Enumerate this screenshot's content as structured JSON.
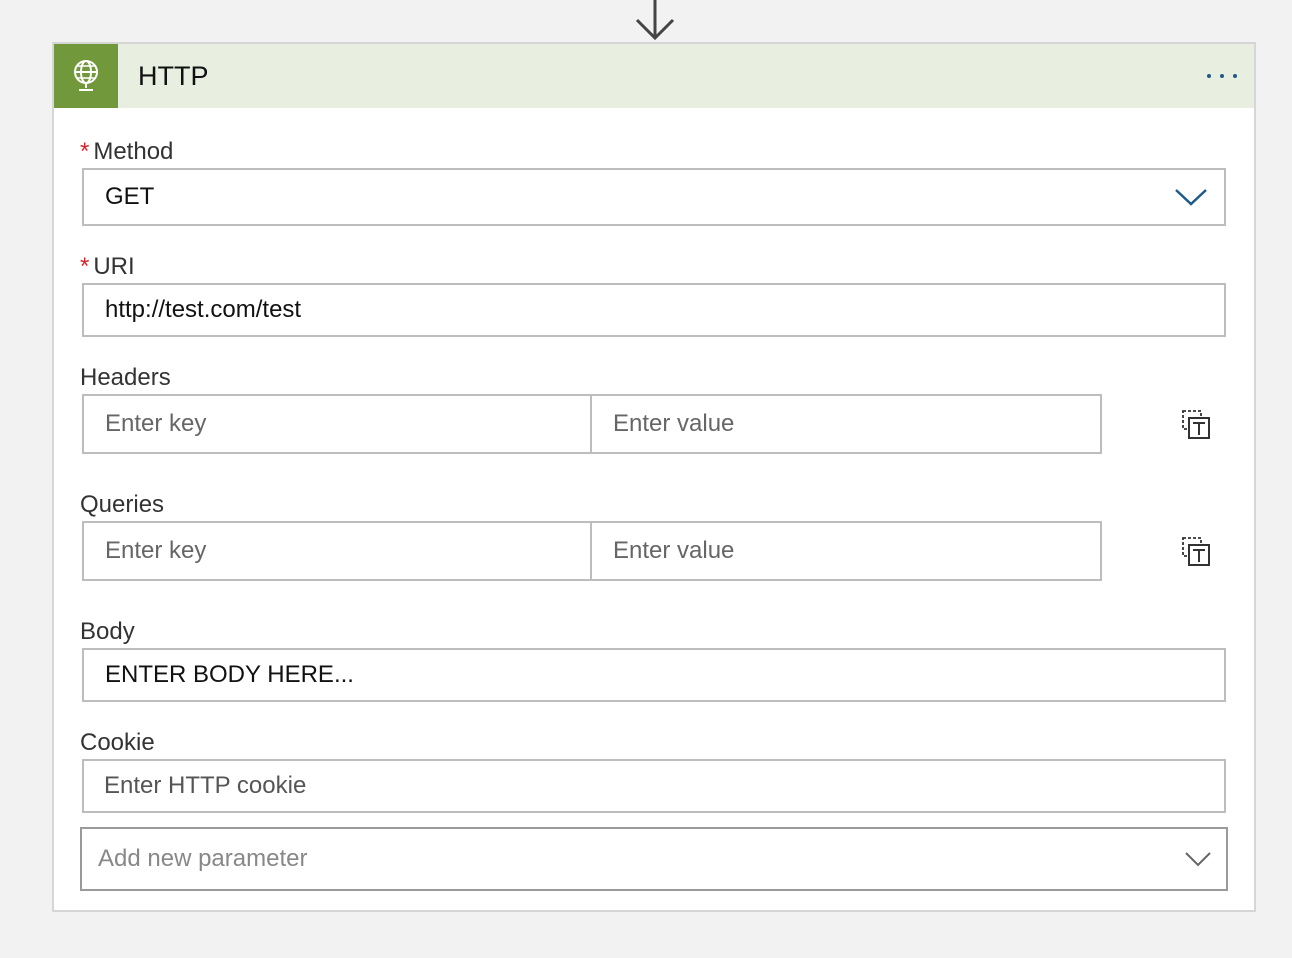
{
  "header": {
    "title": "HTTP",
    "icon": "globe-icon",
    "accent_color": "#71983a",
    "header_bg": "#e8eee0"
  },
  "method": {
    "label": "Method",
    "required_mark": "*",
    "value": "GET"
  },
  "uri": {
    "label": "URI",
    "required_mark": "*",
    "value": "http://test.com/test"
  },
  "headers": {
    "label": "Headers",
    "key_placeholder": "Enter key",
    "value_placeholder": "Enter value"
  },
  "queries": {
    "label": "Queries",
    "key_placeholder": "Enter key",
    "value_placeholder": "Enter value"
  },
  "body": {
    "label": "Body",
    "value": "ENTER BODY HERE..."
  },
  "cookie": {
    "label": "Cookie",
    "placeholder": "Enter HTTP cookie"
  },
  "add_parameter": {
    "placeholder": "Add new parameter"
  }
}
